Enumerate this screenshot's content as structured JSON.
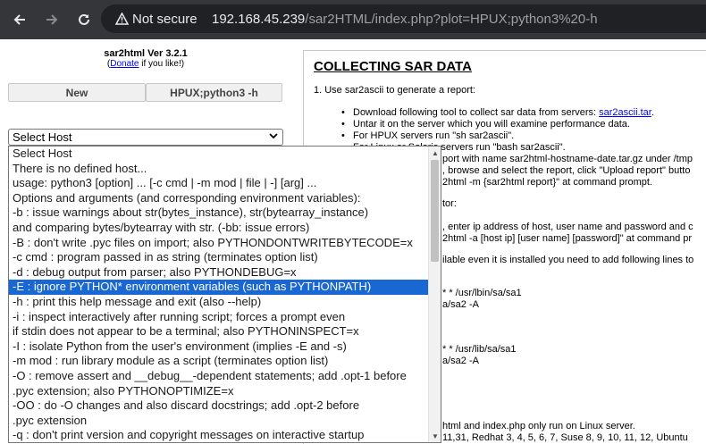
{
  "browser": {
    "back_icon": "arrow-left-icon",
    "forward_icon": "arrow-right-icon",
    "reload_icon": "reload-icon",
    "security_label": "Not secure",
    "url_host": "192.168.45.239",
    "url_path": "/sar2HTML/index.php?plot=HPUX;python3%20-h"
  },
  "left": {
    "title": "sar2html Ver 3.2.1",
    "donate_prefix": "(",
    "donate_link": "Donate",
    "donate_suffix": " if you like!)",
    "new_button": "New",
    "hpux_button": "HPUX;python3 -h",
    "select_value": "Select Host"
  },
  "dropdown": {
    "options": [
      "Select Host",
      "There is no defined host...",
      "usage: python3 [option] ... [-c cmd | -m mod | file | -] [arg] ...",
      "Options and arguments (and corresponding environment variables):",
      "-b : issue warnings about str(bytes_instance), str(bytearray_instance)",
      "and comparing bytes/bytearray with str. (-bb: issue errors)",
      "-B : don't write .pyc files on import; also PYTHONDONTWRITEBYTECODE=x",
      "-c cmd : program passed in as string (terminates option list)",
      "-d : debug output from parser; also PYTHONDEBUG=x",
      "-E : ignore PYTHON* environment variables (such as PYTHONPATH)",
      "-h : print this help message and exit (also --help)",
      "-i : inspect interactively after running script; forces a prompt even",
      "if stdin does not appear to be a terminal; also PYTHONINSPECT=x",
      "-I : isolate Python from the user's environment (implies -E and -s)",
      "-m mod : run library module as a script (terminates option list)",
      "-O : remove assert and __debug__-dependent statements; add .opt-1 before",
      ".pyc extension; also PYTHONOPTIMIZE=x",
      "-OO : do -O changes and also discard docstrings; add .opt-2 before",
      ".pyc extension",
      "-q : don't print version and copyright messages on interactive startup"
    ],
    "selected_index": 9
  },
  "right": {
    "heading": "COLLECTING SAR DATA",
    "step1": "1. Use sar2ascii to generate a report:",
    "b1_text": "Download following tool to collect sar data from servers: ",
    "b1_link": "sar2ascii.tar",
    "b1_end": ".",
    "b2": "Untar it on the server which you will examine performance data.",
    "b3": "For HPUX servers run \"sh sar2ascii\".",
    "b4": "For Linux or Solaris servers run \"bash sar2ascii\".",
    "frag1": "port with name sar2html-hostname-date.tar.gz under /tmp",
    "frag2": ", browse and select the report, click \"Upload report\" butto",
    "frag3": "2html -m {sar2html report}\" at command prompt.",
    "frag4": "tor:",
    "frag5": ", enter ip address of host, user name and password and c",
    "frag6": "2html -a [host ip] [user name] [password]\" at command pr",
    "frag7": "ilable even it is installed you need to add following lines to",
    "frag8": "* * /usr/lbin/sa/sa1",
    "frag9": "a/sa2 -A",
    "frag10": "* * /usr/lib/sa/sa1",
    "frag11": "a/sa2 -A",
    "frag12": "html and index.php only run on Linux server.",
    "frag13": "11,31, Redhat 3, 4, 5, 6, 7, Suse 8, 9, 10, 11, 12, Ubuntu"
  }
}
